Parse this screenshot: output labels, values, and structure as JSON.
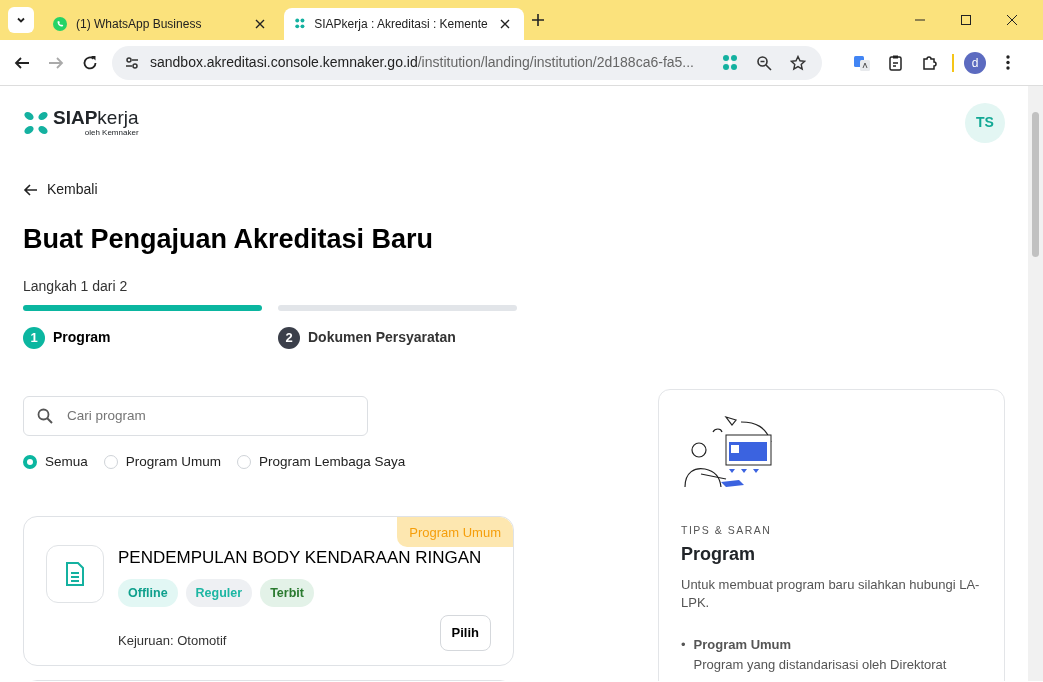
{
  "browser": {
    "tabs": [
      {
        "title": "(1) WhatsApp Business",
        "selected": false
      },
      {
        "title": "SIAPkerja : Akreditasi : Kemente",
        "selected": true
      }
    ],
    "url": {
      "host": "sandbox.akreditasi.console.kemnaker.go.id",
      "path": "/institution/landing/institution/2d188ca6-fa5..."
    },
    "profile": "d"
  },
  "header": {
    "logo_bold": "SIAP",
    "logo_light": "kerja",
    "logo_sub": "oleh Kemnaker",
    "user_initials": "TS"
  },
  "back": "Kembali",
  "title": "Buat Pengajuan Akreditasi Baru",
  "step_label": "Langkah 1 dari 2",
  "steps": [
    {
      "number": "1",
      "label": "Program",
      "selected": true
    },
    {
      "number": "2",
      "label": "Dokumen Persyaratan",
      "selected": false
    }
  ],
  "search": {
    "placeholder": "Cari program"
  },
  "filters": [
    {
      "label": "Semua",
      "selected": true
    },
    {
      "label": "Program Umum",
      "selected": false
    },
    {
      "label": "Program Lembaga Saya",
      "selected": false
    }
  ],
  "programs": [
    {
      "category": "Program Umum",
      "title": "PENDEMPULAN BODY KENDARAAN RINGAN",
      "tags": [
        {
          "label": "Offline",
          "kind": "mode"
        },
        {
          "label": "Reguler",
          "kind": "type"
        },
        {
          "label": "Terbit",
          "kind": "status"
        }
      ],
      "kejuruan": "Kejuruan: Otomotif",
      "button": "Pilih"
    }
  ],
  "tips": {
    "eyebrow": "TIPS & SARAN",
    "title": "Program",
    "text": "Untuk membuat program baru silahkan hubungi LA-LPK.",
    "items": [
      {
        "marker": "•",
        "title": "Program Umum",
        "text": "Program yang distandarisasi oleh Direktorat"
      }
    ]
  }
}
